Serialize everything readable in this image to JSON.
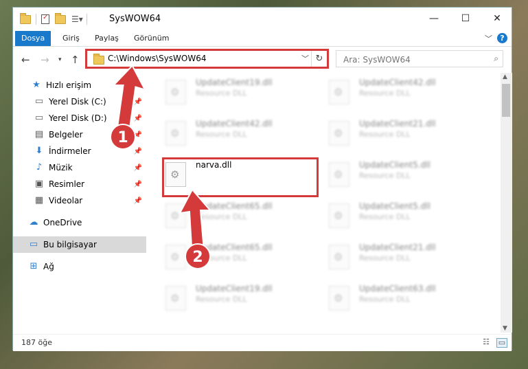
{
  "window": {
    "title": "SysWOW64",
    "minimize": "—",
    "maximize": "☐",
    "close": "✕"
  },
  "ribbon": {
    "tabs": [
      "Dosya",
      "Giriş",
      "Paylaş",
      "Görünüm"
    ],
    "help": "?"
  },
  "navbar": {
    "address": "C:\\Windows\\SysWOW64",
    "search_placeholder": "Ara: SysWOW64"
  },
  "sidebar": {
    "items": [
      {
        "label": "Hızlı erişim",
        "icon": "star-icon"
      },
      {
        "label": "Yerel Disk (C:)",
        "icon": "drive-icon"
      },
      {
        "label": "Yerel Disk (D:)",
        "icon": "drive-icon"
      },
      {
        "label": "Belgeler",
        "icon": "documents-icon"
      },
      {
        "label": "İndirmeler",
        "icon": "download-icon"
      },
      {
        "label": "Müzik",
        "icon": "music-icon"
      },
      {
        "label": "Resimler",
        "icon": "pictures-icon"
      },
      {
        "label": "Videolar",
        "icon": "videos-icon"
      },
      {
        "label": "OneDrive",
        "icon": "cloud-icon"
      },
      {
        "label": "Bu bilgisayar",
        "icon": "computer-icon"
      },
      {
        "label": "Ağ",
        "icon": "network-icon"
      }
    ]
  },
  "files": [
    {
      "name": "UpdateClient19.dll",
      "type": "Resource DLL"
    },
    {
      "name": "UpdateClient42.dll",
      "type": "Resource DLL"
    },
    {
      "name": "UpdateClient42.dll",
      "type": "Resource DLL"
    },
    {
      "name": "UpdateClient21.dll",
      "type": "Resource DLL"
    },
    {
      "name": "narva.dll",
      "type": ""
    },
    {
      "name": "UpdateClient5.dll",
      "type": "Resource DLL"
    },
    {
      "name": "UpdateClient65.dll",
      "type": "Resource DLL"
    },
    {
      "name": "UpdateClient5.dll",
      "type": "Resource DLL"
    },
    {
      "name": "UpdateClient65.dll",
      "type": "Resource DLL"
    },
    {
      "name": "UpdateClient21.dll",
      "type": "Resource DLL"
    },
    {
      "name": "UpdateClient19.dll",
      "type": "Resource DLL"
    },
    {
      "name": "UpdateClient63.dll",
      "type": "Resource DLL"
    }
  ],
  "status": {
    "count": "187 öğe"
  },
  "annotations": {
    "step1": "1",
    "step2": "2",
    "color": "#d43a3a"
  }
}
